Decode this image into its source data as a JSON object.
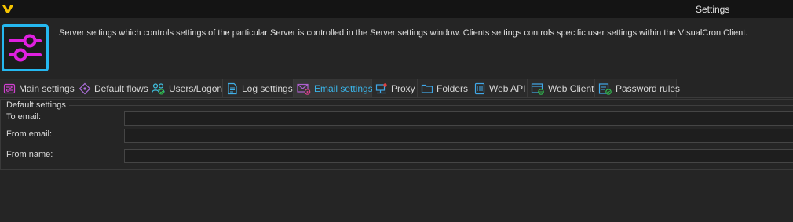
{
  "window": {
    "title": "Settings"
  },
  "header": {
    "description": "Server settings which controls settings of the particular Server is controlled in the Server settings window. Clients settings controls specific user settings within the VIsualCron Client.",
    "icon": "sliders-icon",
    "icon_color": "#e020e0",
    "border_color": "#25b8f0"
  },
  "tabs": [
    {
      "label": "Main settings",
      "icon": "settings-list-icon"
    },
    {
      "label": "Default flows",
      "icon": "flow-diamond-icon"
    },
    {
      "label": "Users/Logon",
      "icon": "users-icon"
    },
    {
      "label": "Log settings",
      "icon": "log-document-icon"
    },
    {
      "label": "Email settings",
      "icon": "email-gear-icon",
      "active": true
    },
    {
      "label": "Proxy",
      "icon": "proxy-network-icon"
    },
    {
      "label": "Folders",
      "icon": "folder-icon"
    },
    {
      "label": "Web API",
      "icon": "web-api-icon"
    },
    {
      "label": "Web Client",
      "icon": "web-client-icon"
    },
    {
      "label": "Password rules",
      "icon": "password-check-icon"
    }
  ],
  "colors": {
    "accent": "#3ab4e8",
    "active_tab_text": "#3ab4e8"
  },
  "default_settings": {
    "title": "Default settings",
    "fields": [
      {
        "label": "To email:",
        "value": ""
      },
      {
        "label": "From email:",
        "value": ""
      },
      {
        "label": "From name:",
        "value": ""
      }
    ]
  }
}
